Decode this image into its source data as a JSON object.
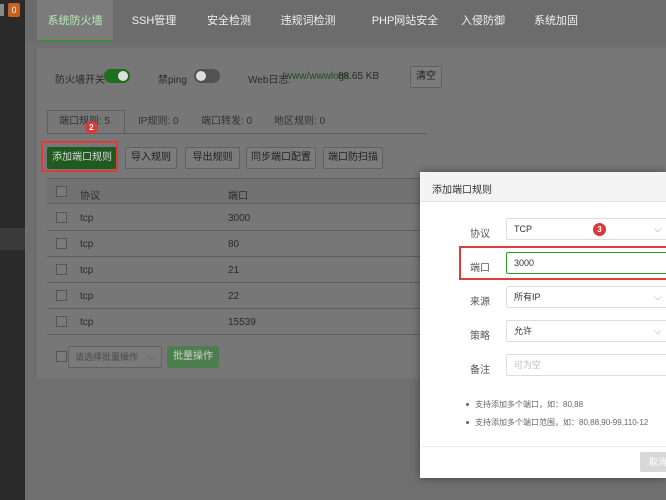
{
  "sidebar": {
    "badge": "0"
  },
  "tabs": [
    {
      "label": "系统防火墙"
    },
    {
      "label": "SSH管理"
    },
    {
      "label": "安全检测"
    },
    {
      "label": "违规词检测"
    },
    {
      "label": "PHP网站安全"
    },
    {
      "label": "入侵防御"
    },
    {
      "label": "系统加固"
    }
  ],
  "status": {
    "firewall_label": "防火墙开关",
    "ping_label": "禁ping",
    "weblog_label": "Web日志:",
    "weblog_path": "/www/wwwlogs",
    "weblog_size": "88.65 KB",
    "clear_label": "清空"
  },
  "subtabs": [
    {
      "label": "端口规则: 5"
    },
    {
      "label": "IP规则: 0"
    },
    {
      "label": "端口转发: 0"
    },
    {
      "label": "地区规则: 0"
    }
  ],
  "toolbar": {
    "add": "添加端口规则",
    "import": "导入规则",
    "export": "导出规则",
    "sync": "同步端口配置",
    "scan": "端口防扫描"
  },
  "table": {
    "headers": {
      "protocol": "协议",
      "port": "端口"
    },
    "rows": [
      {
        "protocol": "tcp",
        "port": "3000"
      },
      {
        "protocol": "tcp",
        "port": "80"
      },
      {
        "protocol": "tcp",
        "port": "21"
      },
      {
        "protocol": "tcp",
        "port": "22"
      },
      {
        "protocol": "tcp",
        "port": "15539"
      }
    ]
  },
  "batch": {
    "select_placeholder": "请选择批量操作",
    "button": "批量操作"
  },
  "annotations": {
    "step2": "2",
    "step3": "3"
  },
  "modal": {
    "title": "添加端口规则",
    "protocol_label": "协议",
    "protocol_value": "TCP",
    "port_label": "端口",
    "port_value": "3000",
    "source_label": "来源",
    "source_value": "所有IP",
    "strategy_label": "策略",
    "strategy_value": "允许",
    "remark_label": "备注",
    "remark_placeholder": "可为空",
    "tip1": "支持添加多个端口，如：80,88",
    "tip2": "支持添加多个端口范围，如：80,88,90-99,110-12",
    "cancel": "取消"
  },
  "colors": {
    "accent": "#20a53a",
    "annotation": "#e03b3b"
  }
}
